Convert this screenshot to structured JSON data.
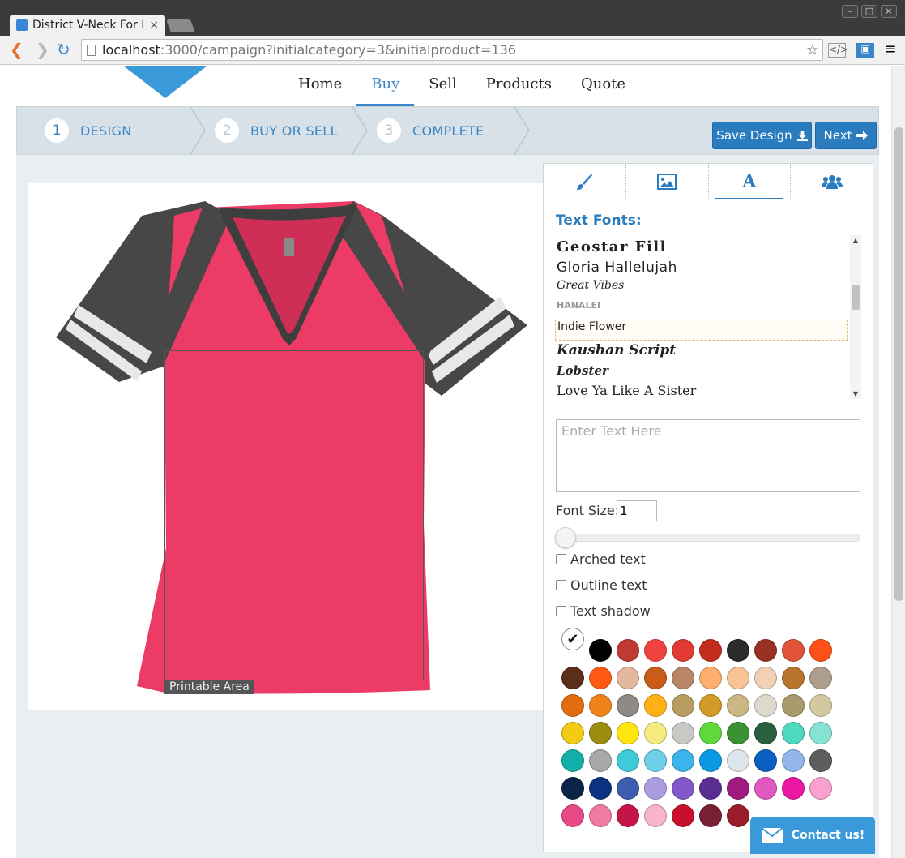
{
  "browser": {
    "tab_title": "District V-Neck For L",
    "url_host": "localhost",
    "url_rest": ":3000/campaign?initialcategory=3&initialproduct=136"
  },
  "nav": {
    "items": [
      "Home",
      "Buy",
      "Sell",
      "Products",
      "Quote"
    ],
    "active": "Buy"
  },
  "steps": [
    {
      "num": "1",
      "label": "DESIGN"
    },
    {
      "num": "2",
      "label": "BUY OR SELL"
    },
    {
      "num": "3",
      "label": "COMPLETE"
    }
  ],
  "actions": {
    "save_label": "Save Design",
    "next_label": "Next"
  },
  "canvas": {
    "printable_label": "Printable Area"
  },
  "panel": {
    "section_title": "Text Fonts:",
    "fonts": [
      "Geostar Fill",
      "Gloria Hallelujah",
      "Great Vibes",
      "HANALEI",
      "Indie Flower",
      "Kaushan Script",
      "Lobster",
      "Love Ya Like A Sister"
    ],
    "selected_font": "Indie Flower",
    "text_placeholder": "Enter Text Here",
    "font_size_label": "Font Size:",
    "font_size_value": "1",
    "arched_label": "Arched text",
    "outline_label": "Outline text",
    "shadow_label": "Text shadow"
  },
  "colors": [
    "#000000",
    "#c03a34",
    "#f0423e",
    "#e03a32",
    "#c42c1e",
    "#2b2b2b",
    "#9a3224",
    "#e0523a",
    "#ff5018",
    "#5a2e1a",
    "#ff5a14",
    "#e4b89e",
    "#c85c18",
    "#b88666",
    "#ffae6e",
    "#f8c496",
    "#f2d0b4",
    "#b8742c",
    "#ae9e8e",
    "#e26c10",
    "#ee8418",
    "#8e8a86",
    "#ffb016",
    "#b89c62",
    "#d29a26",
    "#cab884",
    "#dcdacc",
    "#a89c6c",
    "#d4c8a0",
    "#f2cc14",
    "#9c8c10",
    "#ffe610",
    "#f4ec80",
    "#c8c8c4",
    "#5ed83a",
    "#3a9232",
    "#286040",
    "#4ed8c0",
    "#86e2d2",
    "#12b0a8",
    "#a8a8a8",
    "#3ecad8",
    "#6ed0e8",
    "#3ab4ea",
    "#0a9ae4",
    "#dce4ec",
    "#0a60c0",
    "#92b6e8",
    "#5e5e5e",
    "#0a2448",
    "#0a3280",
    "#3e5cb0",
    "#ac9ce0",
    "#8258c8",
    "#5a2e90",
    "#a01a80",
    "#e058c0",
    "#ea18a0",
    "#f8a0ce",
    "#e84a88",
    "#f07aa4",
    "#c41448",
    "#f8b4c8",
    "#c8102e",
    "#782034",
    "#9a1c2a"
  ],
  "contact": {
    "label": "Contact us!"
  }
}
